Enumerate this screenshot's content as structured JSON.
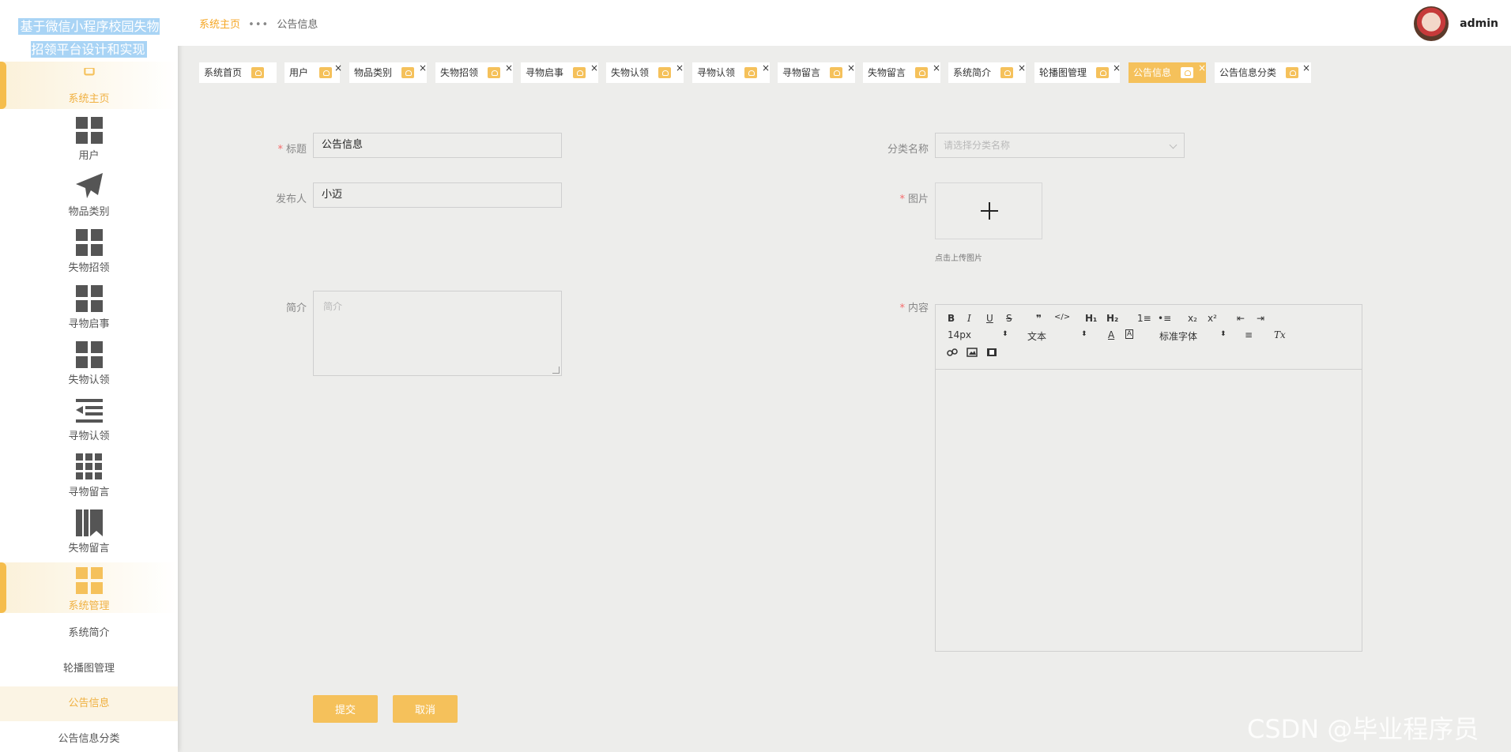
{
  "app": {
    "title": "基于微信小程序校园失物招领平台设计和实现"
  },
  "sidebar": {
    "items": [
      {
        "label": "系统主页",
        "icon": "home-icon",
        "active": true
      },
      {
        "label": "用户",
        "icon": "grid-icon"
      },
      {
        "label": "物品类别",
        "icon": "paper-plane-icon"
      },
      {
        "label": "失物招领",
        "icon": "grid-icon"
      },
      {
        "label": "寻物启事",
        "icon": "grid-icon"
      },
      {
        "label": "失物认领",
        "icon": "grid-icon"
      },
      {
        "label": "寻物认领",
        "icon": "list-indent-icon"
      },
      {
        "label": "寻物留言",
        "icon": "nine-grid-icon"
      },
      {
        "label": "失物留言",
        "icon": "bookmark-icon"
      },
      {
        "label": "系统管理",
        "icon": "grid-icon",
        "active": true
      }
    ],
    "submenu": [
      {
        "label": "系统简介"
      },
      {
        "label": "轮播图管理"
      },
      {
        "label": "公告信息",
        "active": true
      },
      {
        "label": "公告信息分类"
      }
    ]
  },
  "header": {
    "breadcrumb": {
      "home": "系统主页",
      "separator": "•••",
      "current": "公告信息"
    },
    "user": {
      "name": "admin"
    }
  },
  "tabs": [
    {
      "label": "系统首页"
    },
    {
      "label": "用户"
    },
    {
      "label": "物品类别"
    },
    {
      "label": "失物招领"
    },
    {
      "label": "寻物启事"
    },
    {
      "label": "失物认领"
    },
    {
      "label": "寻物认领"
    },
    {
      "label": "寻物留言"
    },
    {
      "label": "失物留言"
    },
    {
      "label": "系统简介"
    },
    {
      "label": "轮播图管理"
    },
    {
      "label": "公告信息",
      "active": true
    },
    {
      "label": "公告信息分类"
    }
  ],
  "form": {
    "title": {
      "label": "标题",
      "value": "公告信息",
      "required": true
    },
    "category": {
      "label": "分类名称",
      "placeholder": "请选择分类名称"
    },
    "publisher": {
      "label": "发布人",
      "value": "小迈"
    },
    "image": {
      "label": "图片",
      "required": true,
      "hint": "点击上传图片"
    },
    "summary": {
      "label": "简介",
      "placeholder": "简介"
    },
    "content": {
      "label": "内容",
      "required": true
    }
  },
  "editor": {
    "font_size": "14px",
    "text_style": "文本",
    "font_family": "标准字体",
    "buttons": {
      "bold": "B",
      "italic": "I",
      "underline": "U",
      "strike": "S",
      "quote": "❞",
      "code": "</>",
      "h1": "H₁",
      "h2": "H₂",
      "ordered": "1≡",
      "bullet": "•≡",
      "sub": "x₂",
      "sup": "x²",
      "outdent": "⇤",
      "indent": "⇥",
      "color": "A",
      "bg": "A",
      "align": "≡",
      "clean": "Tx"
    }
  },
  "actions": {
    "submit": "提交",
    "cancel": "取消"
  },
  "watermark": "CSDN @毕业程序员",
  "colors": {
    "accent": "#f5c15b",
    "accent_text": "#f0b040",
    "required": "#f56c6c",
    "brand_highlight": "#a9d4f5"
  }
}
